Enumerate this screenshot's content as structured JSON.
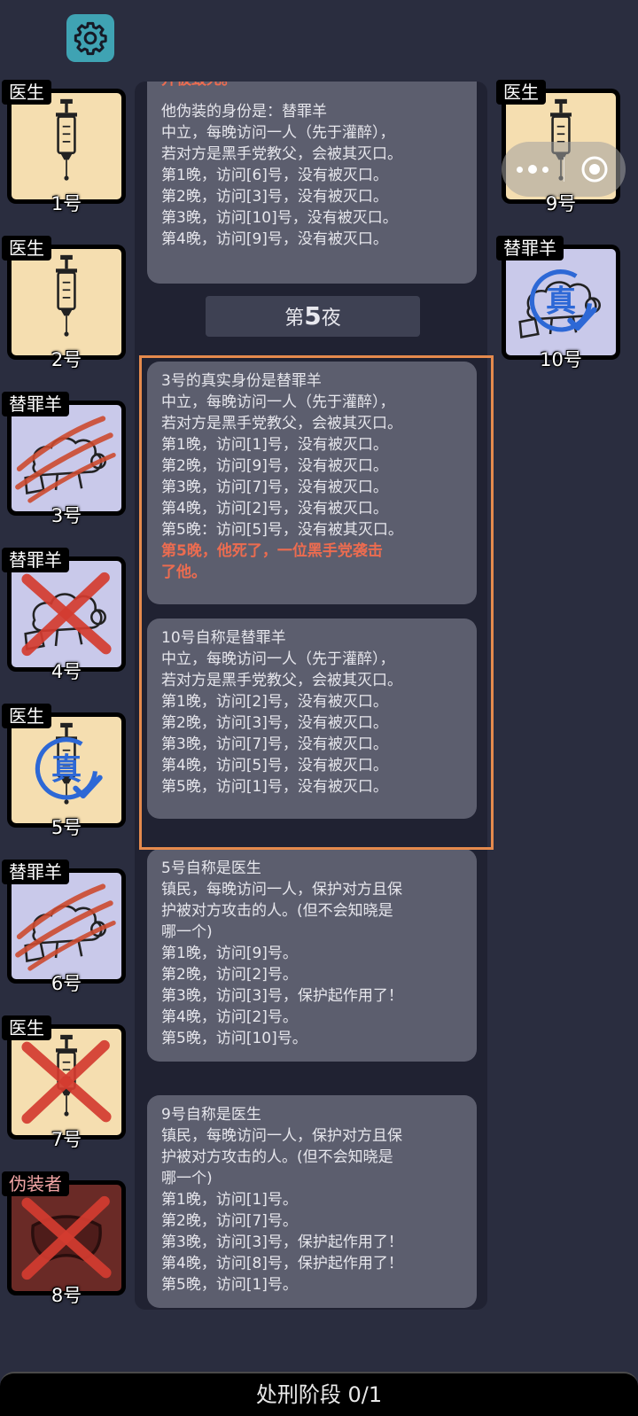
{
  "players": [
    {
      "num": "1号",
      "role": "医生"
    },
    {
      "num": "2号",
      "role": "医生"
    },
    {
      "num": "3号",
      "role": "替罪羊"
    },
    {
      "num": "4号",
      "role": "替罪羊"
    },
    {
      "num": "5号",
      "role": "医生",
      "stamp": "真"
    },
    {
      "num": "6号",
      "role": "替罪羊"
    },
    {
      "num": "7号",
      "role": "医生"
    },
    {
      "num": "8号",
      "role": "伪装者"
    },
    {
      "num": "9号",
      "role": "医生"
    },
    {
      "num": "10号",
      "role": "替罪羊",
      "stamp": "真"
    }
  ],
  "log": {
    "top_partial": "并被毁死。",
    "top": [
      "他伪装的身份是：替罪羊",
      "中立，每晚访问一人（先于灌醉），",
      "若对方是黑手党教父，会被其灭口。",
      "第1晚，访问[6]号，没有被灭口。",
      "第2晚，访问[3]号，没有被灭口。",
      "第3晚，访问[10]号，没有被灭口。",
      "第4晚，访问[9]号，没有被灭口。"
    ],
    "night_prefix": "第",
    "night_num": "5",
    "night_suffix": "夜",
    "b3": [
      "3号的真实身份是替罪羊",
      "中立，每晚访问一人（先于灌醉），",
      "若对方是黑手党教父，会被其灭口。",
      "第1晚，访问[1]号，没有被灭口。",
      "第2晚，访问[9]号，没有被灭口。",
      "第3晚，访问[7]号，没有被灭口。",
      "第4晚，访问[2]号，没有被灭口。",
      "第5晚：访问[5]号，没有被其灭口。"
    ],
    "b3_red_1": "第5晚，他死了，一位黑手党袭击",
    "b3_red_2": "了他。",
    "b10": [
      "10号自称是替罪羊",
      "中立，每晚访问一人（先于灌醉），",
      "若对方是黑手党教父，会被其灭口。",
      "第1晚，访问[2]号，没有被灭口。",
      "第2晚，访问[3]号，没有被灭口。",
      "第3晚，访问[7]号，没有被灭口。",
      "第4晚，访问[5]号，没有被灭口。",
      "第5晚，访问[1]号，没有被灭口。"
    ],
    "b5": [
      "5号自称是医生",
      "镇民，每晚访问一人，保护对方且保",
      "护被对方攻击的人。(但不会知晓是",
      "哪一个)",
      "第1晚，访问[9]号。",
      "第2晚，访问[2]号。",
      "第3晚，访问[3]号，保护起作用了！",
      "第4晚，访问[2]号。",
      "第5晚，访问[10]号。"
    ],
    "b9": [
      "9号自称是医生",
      "镇民，每晚访问一人，保护对方且保",
      "护被对方攻击的人。(但不会知晓是",
      "哪一个)",
      "第1晚，访问[1]号。",
      "第2晚，访问[7]号。",
      "第3晚，访问[3]号，保护起作用了！",
      "第4晚，访问[8]号，保护起作用了！",
      "第5晚，访问[1]号。"
    ]
  },
  "bottom": {
    "label": "处刑阶段 0/1"
  },
  "colors": {
    "background": "#2a2d3f",
    "doctor_card": "#f5deb0",
    "scapegoat_card": "#c9c9ea",
    "impostor_card": "#6a2a26",
    "death_text": "#ec6c50",
    "highlight_border": "#e58a4d"
  }
}
